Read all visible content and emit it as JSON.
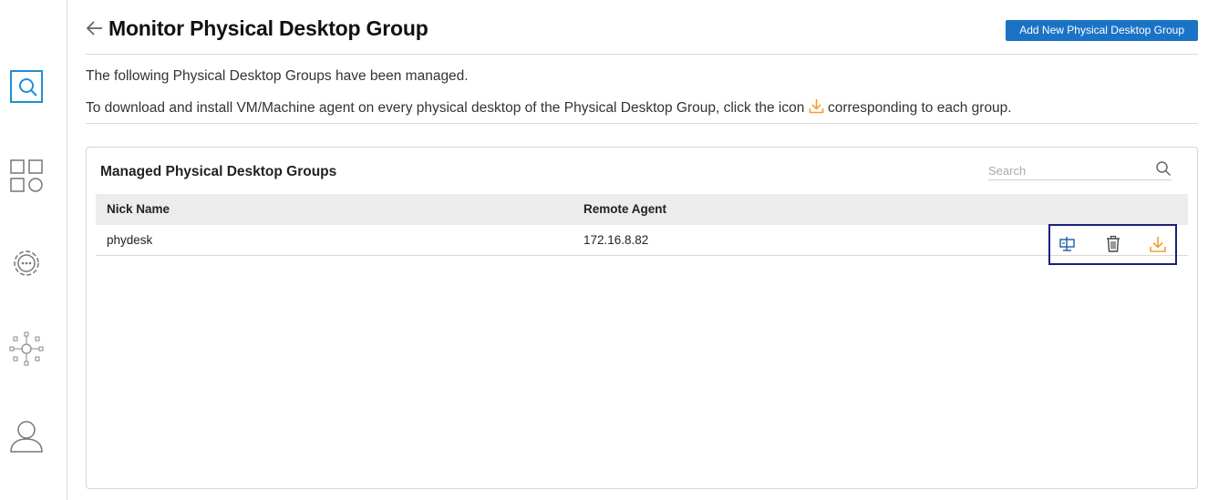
{
  "sidebar": {
    "items": [
      {
        "name": "monitor-icon"
      },
      {
        "name": "grid-icon"
      },
      {
        "name": "settings-icon"
      },
      {
        "name": "network-icon"
      },
      {
        "name": "user-icon"
      }
    ]
  },
  "header": {
    "title": "Monitor Physical Desktop Group",
    "add_button": "Add New Physical Desktop Group"
  },
  "info": {
    "line1": "The following Physical Desktop Groups have been managed.",
    "line2_prefix": "To download and install VM/Machine agent on every physical desktop of the Physical Desktop Group, click the icon",
    "line2_suffix": "corresponding to each group."
  },
  "panel": {
    "title": "Managed Physical Desktop Groups",
    "search_placeholder": "Search",
    "columns": [
      "Nick Name",
      "Remote Agent"
    ],
    "rows": [
      {
        "nick_name": "phydesk",
        "remote_agent": "172.16.8.82"
      }
    ]
  },
  "colors": {
    "accent": "#1b73c6",
    "download": "#f0a030",
    "sidebar_active": "#1e8fd6"
  }
}
